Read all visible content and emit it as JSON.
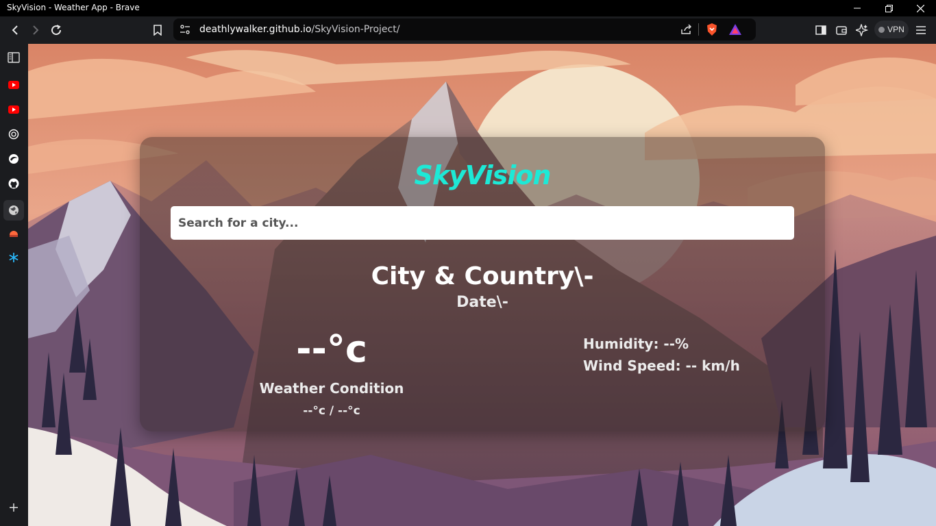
{
  "window": {
    "title": "SkyVision - Weather App - Brave"
  },
  "browser": {
    "url_host": "deathlywalker.github.io",
    "url_path": "/SkyVision-Project/",
    "vpn_label": "VPN"
  },
  "sidebar": {
    "items": [
      {
        "icon": "sidebar-panel-icon"
      },
      {
        "icon": "youtube-icon"
      },
      {
        "icon": "youtube-icon"
      },
      {
        "icon": "chatgpt-icon"
      },
      {
        "icon": "opera-gx-icon"
      },
      {
        "icon": "github-icon"
      },
      {
        "icon": "globe-icon"
      },
      {
        "icon": "skyvision-icon"
      },
      {
        "icon": "snowflake-icon"
      },
      {
        "icon": "plus-icon"
      }
    ]
  },
  "app": {
    "brand": "SkyVision",
    "search_placeholder": "Search for a city...",
    "city": "City & Country\\-",
    "date": "Date\\-",
    "temperature": "--°c",
    "condition": "Weather Condition",
    "range": "--°c / --°c",
    "humidity": "Humidity: --%",
    "wind": "Wind Speed: -- km/h"
  },
  "colors": {
    "brand": "#1de9d6",
    "card_bg": "rgba(40,30,30,0.42)"
  }
}
